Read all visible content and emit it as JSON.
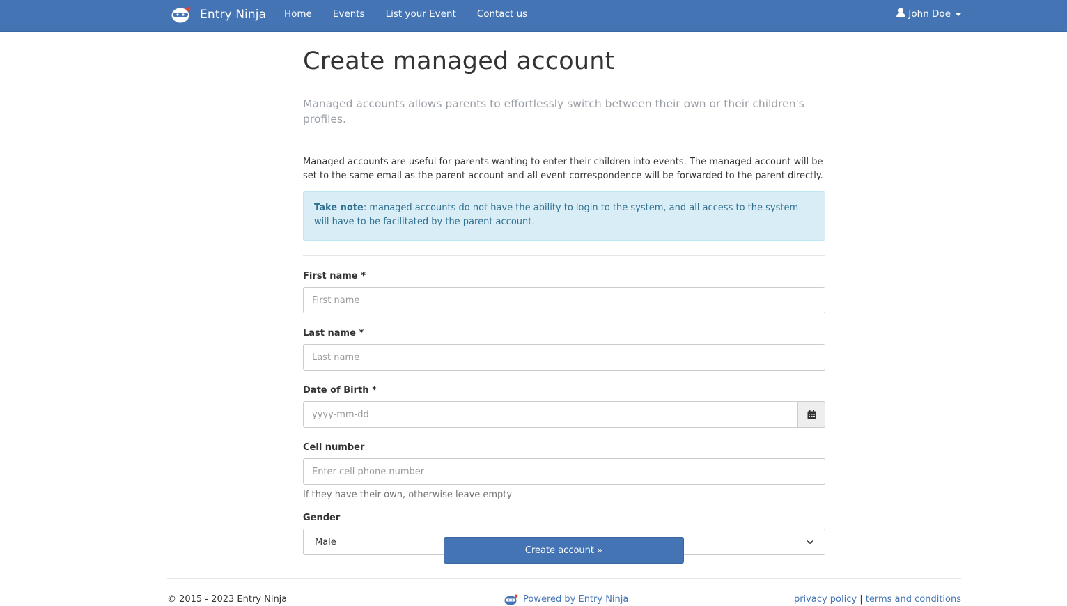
{
  "nav": {
    "brand": "Entry Ninja",
    "links": [
      "Home",
      "Events",
      "List your Event",
      "Contact us"
    ],
    "user": "John Doe"
  },
  "page": {
    "title": "Create managed account",
    "lead": "Managed accounts allows parents to effortlessly switch between their own or their children's profiles.",
    "intro": "Managed accounts are useful for parents wanting to enter their children into events. The managed account will be set to the same email as the parent account and all event correspondence will be forwarded to the parent directly.",
    "note_label": "Take note",
    "note_text": ": managed accounts do not have the ability to login to the system, and all access to the system will have to be facilitated by the parent account."
  },
  "form": {
    "first_name": {
      "label": "First name *",
      "placeholder": "First name",
      "value": ""
    },
    "last_name": {
      "label": "Last name *",
      "placeholder": "Last name",
      "value": ""
    },
    "dob": {
      "label": "Date of Birth *",
      "placeholder": "yyyy-mm-dd",
      "value": "",
      "icon": "calendar-icon"
    },
    "cell": {
      "label": "Cell number",
      "placeholder": "Enter cell phone number",
      "value": "",
      "help": "If they have their-own, otherwise leave empty"
    },
    "gender": {
      "label": "Gender",
      "selected": "Male"
    },
    "submit": "Create account »"
  },
  "footer": {
    "copyright": "© 2015 - 2023 Entry Ninja",
    "powered": "Powered by Entry Ninja",
    "privacy": "privacy policy",
    "separator": "|",
    "terms": "terms and conditions"
  },
  "colors": {
    "primary": "#4474b4",
    "info_bg": "#d9edf7",
    "info_text": "#31708f"
  }
}
